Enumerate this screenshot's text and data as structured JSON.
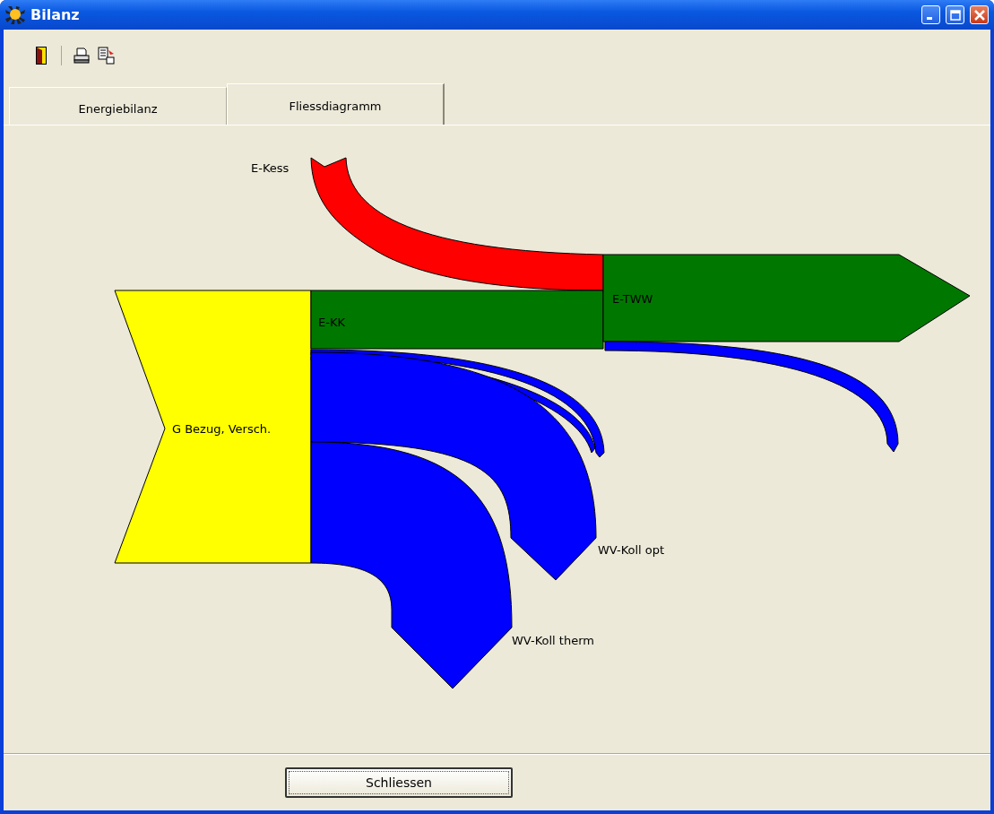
{
  "window": {
    "title": "Bilanz"
  },
  "tabs": [
    {
      "label": "Energiebilanz",
      "selected": false
    },
    {
      "label": "Fliessdiagramm",
      "selected": true
    }
  ],
  "diagram": {
    "flows": [
      {
        "kind": "inflow",
        "label": "E-Kess",
        "color": "#ff0000"
      },
      {
        "kind": "source",
        "label": "G Bezug, Versch.",
        "color": "#ffff00"
      },
      {
        "kind": "band",
        "label": "E-KK",
        "color": "#007800"
      },
      {
        "kind": "arrow",
        "label": "E-TWW",
        "color": "#007800"
      },
      {
        "kind": "return",
        "color": "#0000ff"
      },
      {
        "kind": "strands",
        "color": "#0000ff"
      },
      {
        "kind": "bend",
        "label": "WV-Koll opt",
        "color": "#0000ff"
      },
      {
        "kind": "drop",
        "label": "WV-Koll therm",
        "color": "#0000ff"
      }
    ]
  },
  "buttons": [
    {
      "label": "Schliessen"
    }
  ]
}
